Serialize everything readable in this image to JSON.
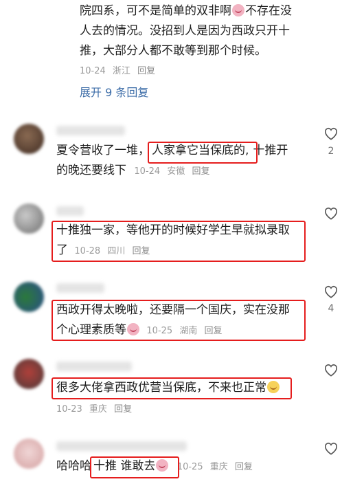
{
  "top_reply": {
    "lines": [
      "院四系，可不是简单的双非啊",
      "不存在没",
      "人去的情况。没招到人是因为西政只开十",
      "推，大部分人都不敢等到那个时候。"
    ],
    "date": "10-24",
    "location": "浙江",
    "reply": "回复",
    "expand": "展开 9 条回复"
  },
  "comments": [
    {
      "text_a": "夏令营收了一堆，",
      "text_b": "人家拿它当保底的,",
      "text_c": "十推开",
      "text_d": "的晚还要线下",
      "date": "10-24",
      "location": "安徽",
      "reply": "回复",
      "likes": "2"
    },
    {
      "text_a": "十推独一家，等他开的时候好学生早就拟录取",
      "text_b": "了",
      "date": "10-28",
      "location": "四川",
      "reply": "回复",
      "likes": ""
    },
    {
      "text_a": "西政开得太晚啦，还要隔一个国庆，实在没那",
      "text_b": "个心理素质等",
      "date": "10-25",
      "location": "湖南",
      "reply": "回复",
      "likes": "4"
    },
    {
      "text_a": "很多大佬拿西政优营当保底，不来也正常",
      "date": "10-23",
      "location": "重庆",
      "reply": "回复",
      "likes": ""
    },
    {
      "text_a": "哈哈哈",
      "text_b": "十推 谁敢去",
      "date": "10-25",
      "location": "重庆",
      "reply": "回复",
      "likes": ""
    }
  ],
  "colors": {
    "highlight": "#e51d1d",
    "link": "#3d6da8",
    "meta": "#9a9a9a"
  },
  "icons": [
    "heart-icon",
    "cry-laugh-emoji",
    "smile-emoji"
  ]
}
